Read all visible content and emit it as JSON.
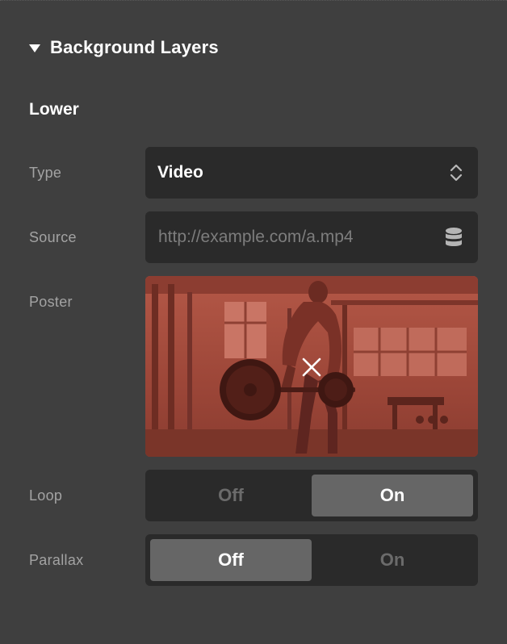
{
  "section": {
    "title": "Background Layers",
    "expanded": true,
    "icon": "caret-down-icon"
  },
  "layer": {
    "title": "Lower",
    "type": {
      "label": "Type",
      "value": "Video",
      "icon": "updown-chevron-icon"
    },
    "source": {
      "label": "Source",
      "placeholder": "http://example.com/a.mp4",
      "icon": "database-icon"
    },
    "poster": {
      "label": "Poster",
      "remove_icon": "close-icon",
      "tint_color": "#a04a3c"
    },
    "loop": {
      "label": "Loop",
      "options": [
        "Off",
        "On"
      ],
      "selected": "On"
    },
    "parallax": {
      "label": "Parallax",
      "options": [
        "Off",
        "On"
      ],
      "selected": "Off"
    }
  },
  "colors": {
    "panel_bg": "#3f3f3f",
    "field_bg": "#2a2a2a",
    "label": "#a3a3a3",
    "active_segment": "#666666",
    "inactive_text": "#6b6b6b"
  }
}
